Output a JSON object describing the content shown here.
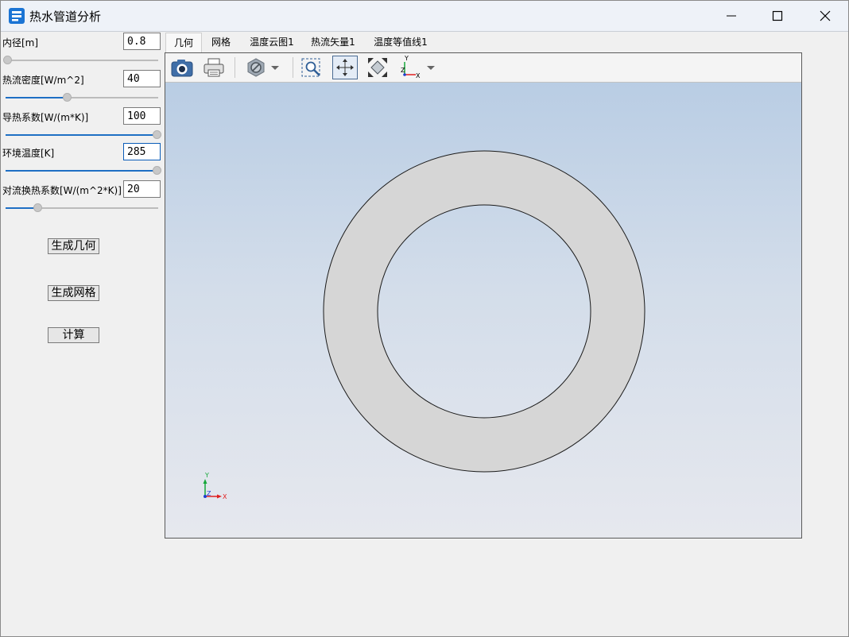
{
  "window": {
    "title": "热水管道分析"
  },
  "params": [
    {
      "label": "内径[m]",
      "value": "0.8",
      "slider_fraction": 0.0
    },
    {
      "label": "热流密度[W/m^2]",
      "value": "40",
      "slider_fraction": 0.4
    },
    {
      "label": "导热系数[W/(m*K)]",
      "value": "100",
      "slider_fraction": 1.0
    },
    {
      "label": "环境温度[K]",
      "value": "285",
      "slider_fraction": 1.0
    },
    {
      "label": "对流换热系数[W/(m^2*K)]",
      "value": "20",
      "slider_fraction": 0.2
    }
  ],
  "buttons": {
    "generate_geometry": "生成几何",
    "generate_mesh": "生成网格",
    "compute": "计算"
  },
  "tabs": [
    {
      "label": "几何",
      "active": true
    },
    {
      "label": "网格",
      "active": false
    },
    {
      "label": "温度云图1",
      "active": false
    },
    {
      "label": "热流矢量1",
      "active": false
    },
    {
      "label": "温度等值线1",
      "active": false
    }
  ],
  "toolbar": {
    "icons": [
      "camera-icon",
      "printer-icon",
      "no-entry-icon",
      "dropdown-arrow-icon",
      "zoom-box-icon",
      "fit-view-icon",
      "expand-view-icon",
      "axes-icon",
      "dropdown-arrow-icon"
    ]
  },
  "axes_labels": {
    "x": "X",
    "y": "Y",
    "z": "Z"
  },
  "colors": {
    "accent": "#1e6fc4",
    "ring_fill": "#d6d6d6",
    "axis_x": "#e02020",
    "axis_y": "#16a83a",
    "axis_z": "#1e3ed0"
  }
}
